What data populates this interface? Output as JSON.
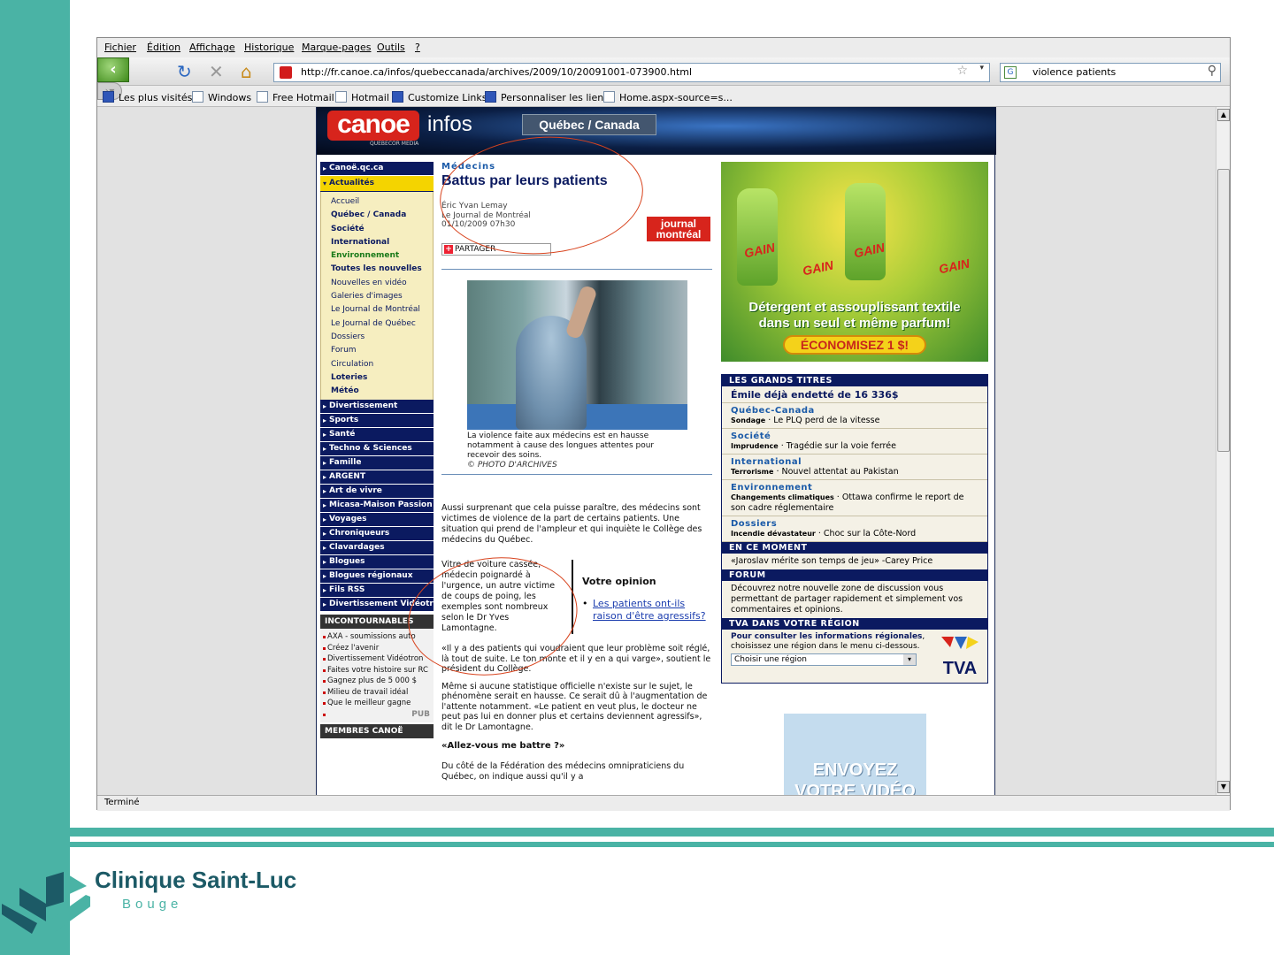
{
  "browser": {
    "menu": [
      "Fichier",
      "Édition",
      "Affichage",
      "Historique",
      "Marque-pages",
      "Outils",
      "?"
    ],
    "url": "http://fr.canoe.ca/infos/quebeccanada/archives/2009/10/20091001-073900.html",
    "search_value": "violence patients",
    "bookmarks": [
      "Les plus visités",
      "Windows",
      "Free Hotmail",
      "Hotmail",
      "Customize Links",
      "Personnaliser les liens",
      "Home.aspx-source=s..."
    ],
    "status": "Terminé"
  },
  "site": {
    "logo": "canoe",
    "logo_sub": "QUEBECOR MEDIA",
    "infos": "infos",
    "section": "Québec / Canada"
  },
  "nav": {
    "top": "Canoë.qc.ca",
    "active": "Actualités",
    "sub": [
      "Accueil",
      "Québec / Canada",
      "Société",
      "International",
      "Environnement",
      "Toutes les nouvelles",
      "Nouvelles en vidéo",
      "Galeries d'images",
      "Le Journal de Montréal",
      "Le Journal de Québec",
      "Dossiers",
      "Forum",
      "Circulation",
      "Loteries",
      "Météo"
    ],
    "main": [
      "Divertissement",
      "Sports",
      "Santé",
      "Techno & Sciences",
      "Famille",
      "ARGENT",
      "Art de vivre",
      "Micasa-Maison Passion",
      "Voyages",
      "Chroniqueurs",
      "Clavardages",
      "Blogues",
      "Blogues régionaux",
      "Fils RSS",
      "Divertissement Vidéotron"
    ],
    "incontournables_title": "INCONTOURNABLES",
    "incontournables": [
      "AXA - soumissions auto",
      "Créez l'avenir",
      "Divertissement Vidéotron",
      "Faites votre histoire sur RC",
      "Gagnez plus de 5 000 $",
      "Milieu de travail idéal",
      "Que le meilleur gagne"
    ],
    "pub": "PUB",
    "members": "MEMBRES CANOË"
  },
  "article": {
    "kicker": "Médecins",
    "headline": "Battus par leurs patients",
    "author": "Éric Yvan Lemay",
    "source": "Le Journal de Montréal",
    "date": "01/10/2009 07h30",
    "jdm_logo_1": "journal",
    "jdm_logo_2": "montréal",
    "share": "PARTAGER",
    "caption": "La violence faite aux médecins est en hausse notamment à cause des longues attentes pour recevoir des soins.",
    "credit": "© PHOTO D'ARCHIVES",
    "para1": "Aussi surprenant que cela puisse paraître, des médecins sont victimes de violence de la part de certains patients. Une situation qui prend de l'ampleur et qui inquiète le Collège des médecins du Québec.",
    "pull_quote": "Vitre de voiture cassée, médecin poignardé à l'urgence, un autre victime de coups de poing, les exemples sont nombreux selon le Dr Yves Lamontagne.",
    "opinion_title": "Votre opinion",
    "opinion_link": "Les patients ont-ils raison d'être agressifs?",
    "para2": "«Il y a des patients qui voudraient que leur problème soit réglé, là tout de suite. Le ton monte et il y en a qui varge», soutient le président du Collège.",
    "para3": "Même si aucune statistique officielle n'existe sur le sujet, le phénomène serait en hausse. Ce serait dû à l'augmentation de l'attente notamment. «Le patient en veut plus, le docteur ne peut pas lui en donner plus et certains deviennent agressifs», dit le Dr Lamontagne.",
    "subhead": "«Allez-vous me battre ?»",
    "para4": "Du côté de la Fédération des médecins omnipraticiens du Québec, on indique aussi qu'il y a"
  },
  "ad1": {
    "brand": "GAIN",
    "text1": "Détergent et assouplissant textile",
    "text2": "dans un seul et même parfum!",
    "cta": "ÉCONOMISEZ 1 $!"
  },
  "titres": {
    "head": "LES GRANDS TITRES",
    "top": "Émile déjà endetté de 16 336$",
    "items": [
      {
        "cat": "Québec-Canada",
        "tag": "Sondage",
        "text": "Le PLQ perd de la vitesse"
      },
      {
        "cat": "Société",
        "tag": "Imprudence",
        "text": "Tragédie sur la voie ferrée"
      },
      {
        "cat": "International",
        "tag": "Terrorisme",
        "text": "Nouvel attentat au Pakistan"
      },
      {
        "cat": "Environnement",
        "tag": "Changements climatiques",
        "text": "Ottawa confirme le report de son cadre réglementaire"
      },
      {
        "cat": "Dossiers",
        "tag": "Incendie dévastateur",
        "text": "Choc sur la Côte-Nord"
      }
    ],
    "moment_head": "EN CE MOMENT",
    "moment": "«Jaroslav mérite son temps de jeu» -Carey Price",
    "forum_head": "FORUM",
    "forum": "Découvrez notre nouvelle zone de discussion vous permettant de partager rapidement et simplement vos commentaires et opinions.",
    "region_head": "TVA DANS VOTRE RÉGION",
    "region_bold": "Pour consulter les informations régionales",
    "region_rest": ", choisissez une région dans le menu ci-dessous.",
    "region_select": "Choisir une région",
    "tva": "TVA"
  },
  "ad2": {
    "text": "ENVOYEZ VOTRE VIDÉO"
  },
  "slide": {
    "clinic": "Clinique Saint-Luc",
    "city": "Bouge"
  }
}
